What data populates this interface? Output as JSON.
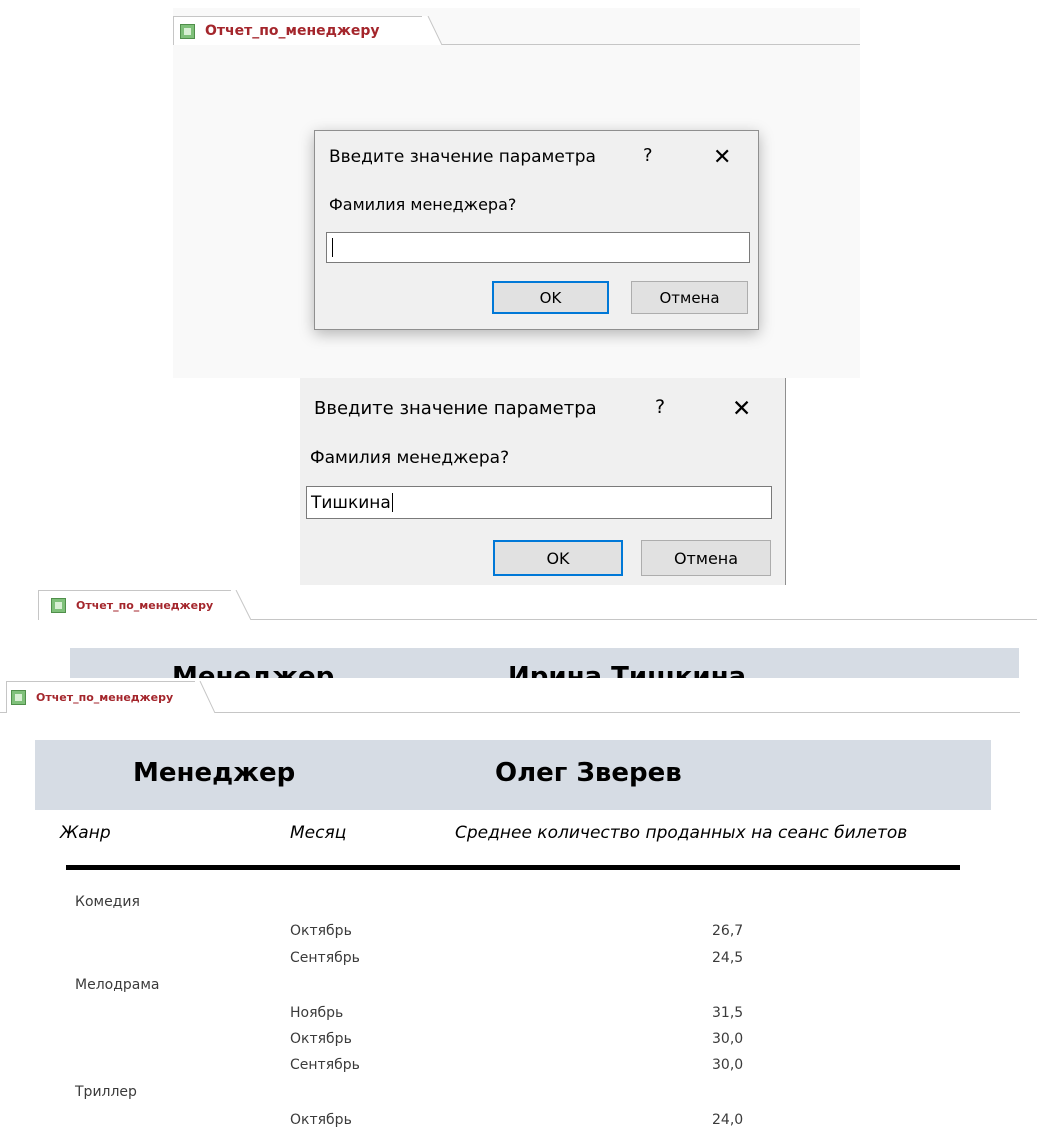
{
  "panel1": {
    "tab_label": "Отчет_по_менеджеру",
    "dialog": {
      "title": "Введите значение параметра",
      "help": "?",
      "close": "✕",
      "prompt": "Фамилия менеджера?",
      "input_value": "",
      "ok": "OK",
      "cancel": "Отмена"
    }
  },
  "panel2": {
    "dialog": {
      "title": "Введите значение параметра",
      "help": "?",
      "close": "✕",
      "prompt": "Фамилия менеджера?",
      "input_value": "Тишкина",
      "ok": "OK",
      "cancel": "Отмена"
    }
  },
  "panel3": {
    "tab_label": "Отчет_по_менеджеру",
    "header_label": "Менеджер",
    "manager_name": "Ирина Тишкина"
  },
  "panel4": {
    "tab_label": "Отчет_по_менеджеру",
    "header_label": "Менеджер",
    "manager_name": "Олег Зверев",
    "columns": [
      "Жанр",
      "Месяц",
      "Среднее количество проданных на сеанс билетов"
    ],
    "groups": [
      {
        "genre": "Комедия",
        "rows": [
          {
            "month": "Октябрь",
            "value": "26,7"
          },
          {
            "month": "Сентябрь",
            "value": "24,5"
          }
        ]
      },
      {
        "genre": "Мелодрама",
        "rows": [
          {
            "month": "Ноябрь",
            "value": "31,5"
          },
          {
            "month": "Октябрь",
            "value": "30,0"
          },
          {
            "month": "Сентябрь",
            "value": "30,0"
          }
        ]
      },
      {
        "genre": "Триллер",
        "rows": [
          {
            "month": "Октябрь",
            "value": "24,0"
          }
        ]
      }
    ]
  },
  "colors": {
    "tab_text": "#a4262c",
    "header_band": "#d6dce4",
    "dialog_bg": "#f0f0f0",
    "default_button_border": "#0078d7"
  }
}
